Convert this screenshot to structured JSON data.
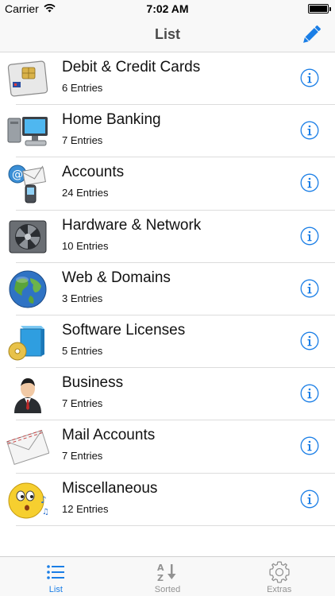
{
  "status": {
    "carrier": "Carrier",
    "time": "7:02 AM"
  },
  "nav": {
    "title": "List"
  },
  "items": [
    {
      "title": "Debit & Credit Cards",
      "subtitle": "6 Entries",
      "icon": "credit-card-icon"
    },
    {
      "title": "Home Banking",
      "subtitle": "7 Entries",
      "icon": "computer-icon"
    },
    {
      "title": "Accounts",
      "subtitle": "24 Entries",
      "icon": "accounts-icon"
    },
    {
      "title": "Hardware & Network",
      "subtitle": "10 Entries",
      "icon": "cpu-cooler-icon"
    },
    {
      "title": "Web & Domains",
      "subtitle": "3 Entries",
      "icon": "globe-icon"
    },
    {
      "title": "Software Licenses",
      "subtitle": "5 Entries",
      "icon": "software-box-icon"
    },
    {
      "title": "Business",
      "subtitle": "7 Entries",
      "icon": "businessman-icon"
    },
    {
      "title": "Mail Accounts",
      "subtitle": "7 Entries",
      "icon": "envelope-icon"
    },
    {
      "title": "Miscellaneous",
      "subtitle": "12 Entries",
      "icon": "whistling-smiley-icon"
    }
  ],
  "tabs": [
    {
      "label": "List",
      "icon": "list-icon",
      "active": true
    },
    {
      "label": "Sorted",
      "icon": "sort-az-icon",
      "active": false
    },
    {
      "label": "Extras",
      "icon": "gear-icon",
      "active": false
    }
  ],
  "colors": {
    "accent": "#1a7ee6",
    "inactive": "#929292",
    "bar": "#f8f8f8"
  }
}
